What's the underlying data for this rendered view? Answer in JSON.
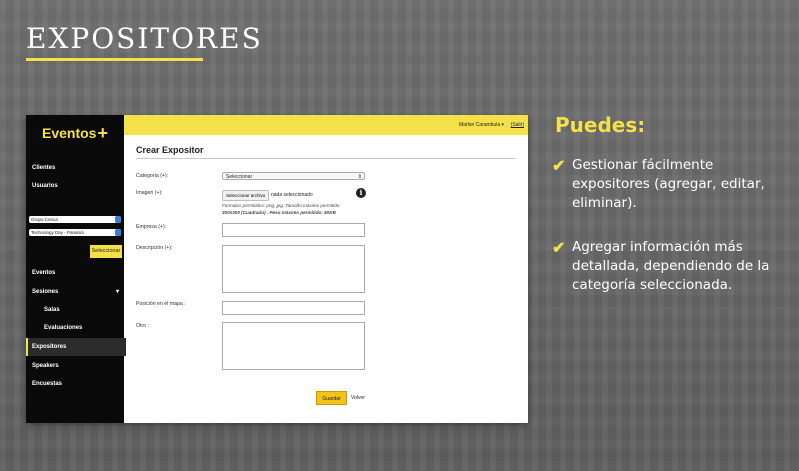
{
  "page": {
    "title": "EXPOSITORES"
  },
  "app": {
    "logo": "Eventos",
    "logo_plus": "+",
    "user": "Marlon Carambula ▾",
    "logout": "(Salir)",
    "sidebar": {
      "items_top": [
        "Clientes",
        "Usuarios"
      ],
      "select_client": "Grupo Cenca",
      "select_event": "Technology Day - Panamá",
      "select_button": "Seleccionar",
      "nav": [
        {
          "label": "Eventos"
        },
        {
          "label": "Sesiones",
          "chevron": "▾"
        },
        {
          "label": "Salas"
        },
        {
          "label": "Evaluaciones"
        },
        {
          "label": "Expositores",
          "active": true
        },
        {
          "label": "Speakers"
        },
        {
          "label": "Encuestas"
        }
      ]
    },
    "form": {
      "title": "Crear Expositor",
      "category_label": "Categoría (+):",
      "category_value": "Seleccionar",
      "image_label": "Imagen (+):",
      "file_button": "Seleccionar archivo",
      "file_status": "nada seleccionado",
      "hint_line1": "Formatos permitidos: png, jpg. Tamaño máximo permitido:",
      "hint_line2": "300x300 (Cuadrado) . Peso máximo permitido: 50KB",
      "company_label": "Empresa (+):",
      "description_label": "Descripción (+):",
      "map_label": "Posición en el mapa :",
      "other_label": "Otro :",
      "save": "Guardar",
      "back": "Volver"
    }
  },
  "info": {
    "title": "Puedes:",
    "items": [
      "Gestionar fácilmente expositores (agregar, editar, eliminar).",
      "Agregar información más detallada, dependiendo de la categoría seleccionada."
    ]
  },
  "colors": {
    "accent": "#f4e14a",
    "sidebar": "#0a0a0a",
    "button": "#f4c21a"
  }
}
